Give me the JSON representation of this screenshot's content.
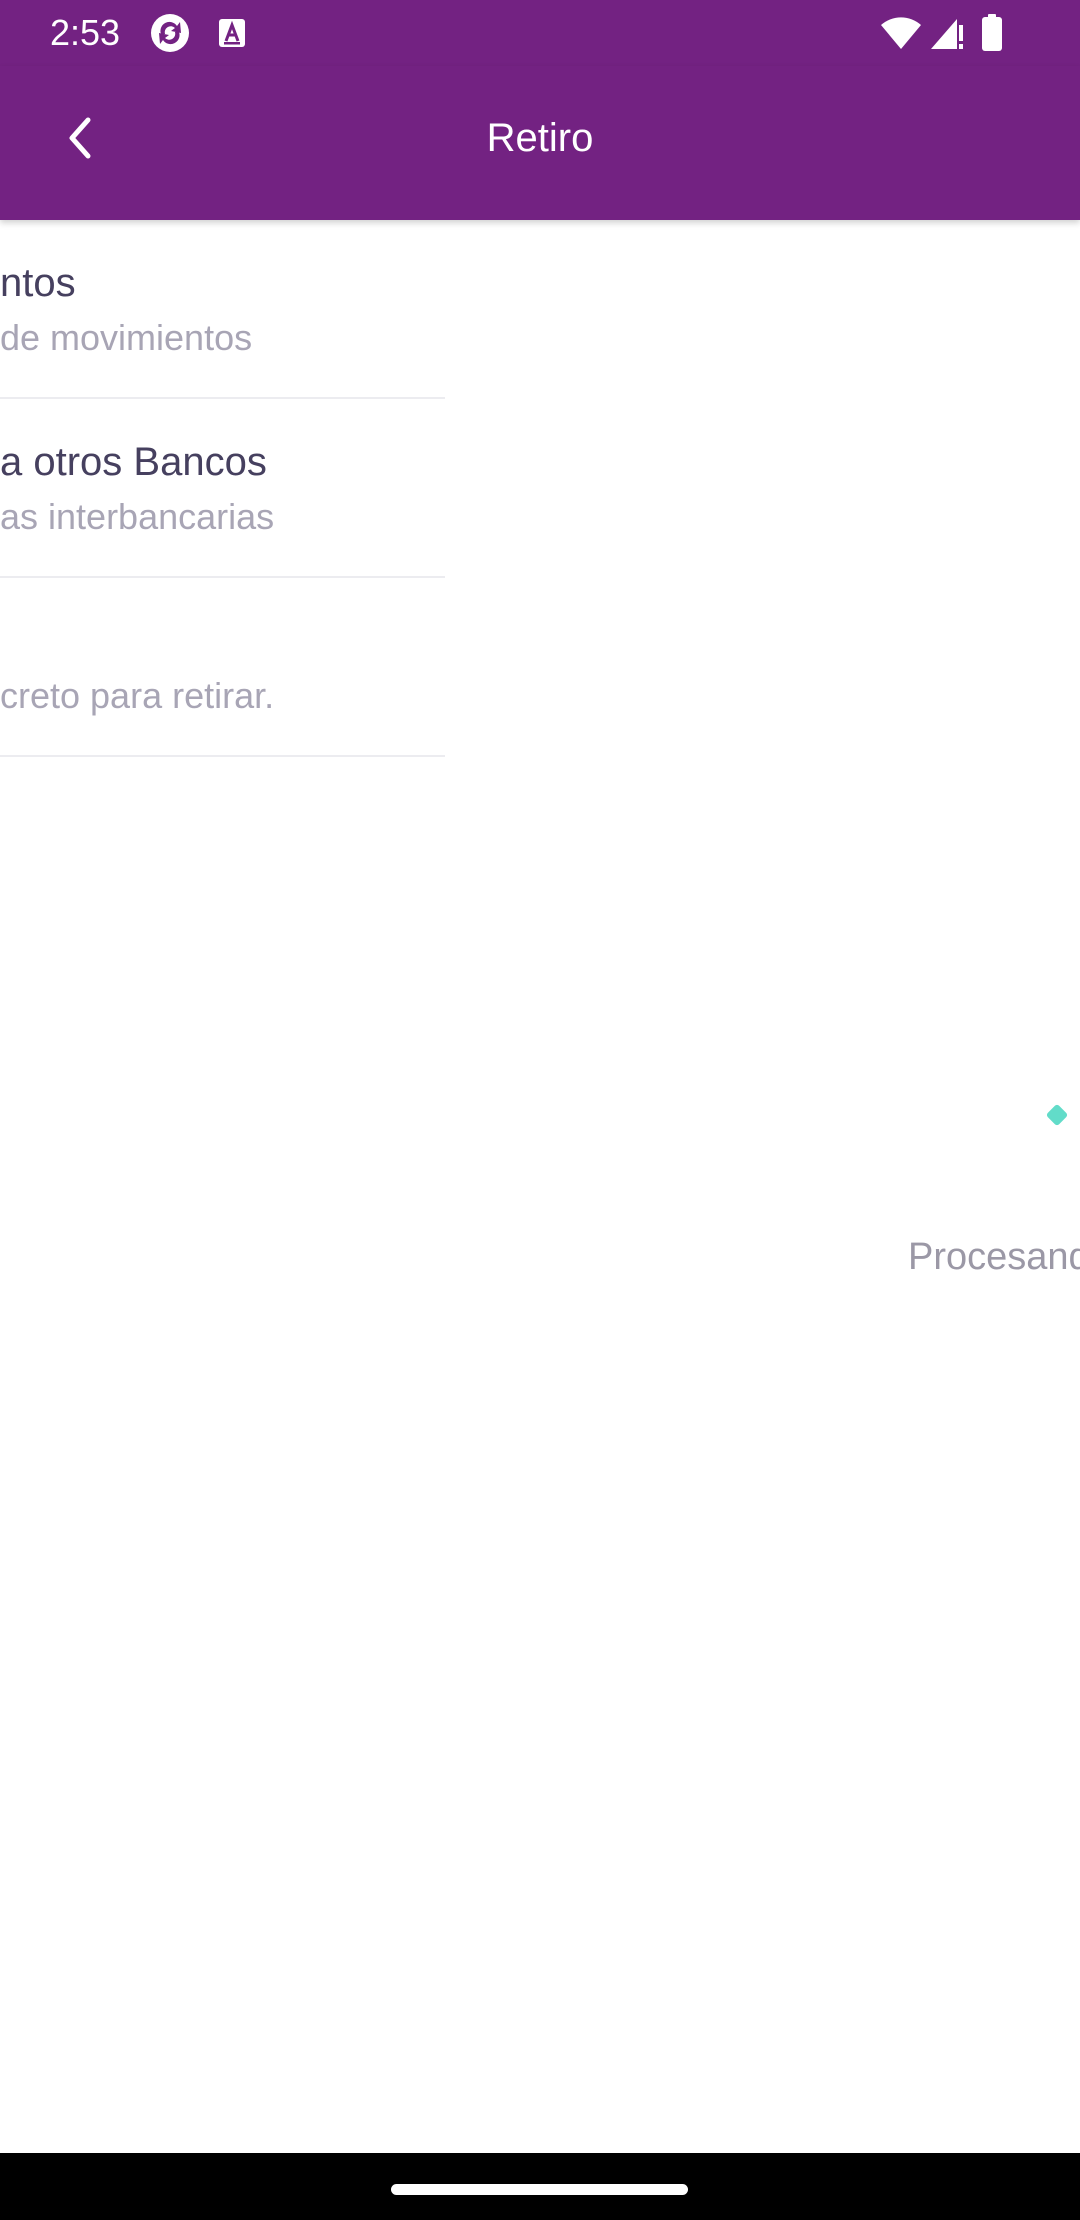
{
  "status_bar": {
    "time": "2:53",
    "icons": [
      "sync-app-icon",
      "accessibility-a-icon",
      "wifi-icon",
      "signal-icon",
      "battery-icon"
    ],
    "background_color": "#732282"
  },
  "app_bar": {
    "title": "Retiro",
    "back_icon": "chevron-left-icon",
    "background_color": "#732282"
  },
  "menu": {
    "items": [
      {
        "title": "ntos",
        "subtitle": "de movimientos"
      },
      {
        "title": "a otros Bancos",
        "subtitle": "as interbancarias"
      },
      {
        "title": "",
        "subtitle": "creto para retirar."
      }
    ]
  },
  "processing": {
    "text": "Procesand",
    "loader_color": "#62dcc9"
  }
}
